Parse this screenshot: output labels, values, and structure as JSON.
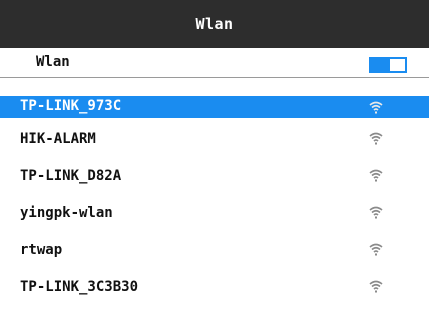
{
  "header": {
    "title": "Wlan"
  },
  "wlan_toggle": {
    "label": "Wlan",
    "enabled": true
  },
  "colors": {
    "header_bg": "#2d2d2d",
    "accent": "#1a8cf0",
    "signal_icon": "#8a8a8a"
  },
  "networks": [
    {
      "ssid": "TP-LINK_973C",
      "selected": true,
      "icon": "wifi-signal-icon"
    },
    {
      "ssid": "HIK-ALARM",
      "selected": false,
      "icon": "wifi-signal-icon"
    },
    {
      "ssid": "TP-LINK_D82A",
      "selected": false,
      "icon": "wifi-signal-icon"
    },
    {
      "ssid": "yingpk-wlan",
      "selected": false,
      "icon": "wifi-signal-icon"
    },
    {
      "ssid": "rtwap",
      "selected": false,
      "icon": "wifi-signal-icon"
    },
    {
      "ssid": "TP-LINK_3C3B30",
      "selected": false,
      "icon": "wifi-signal-icon"
    }
  ]
}
